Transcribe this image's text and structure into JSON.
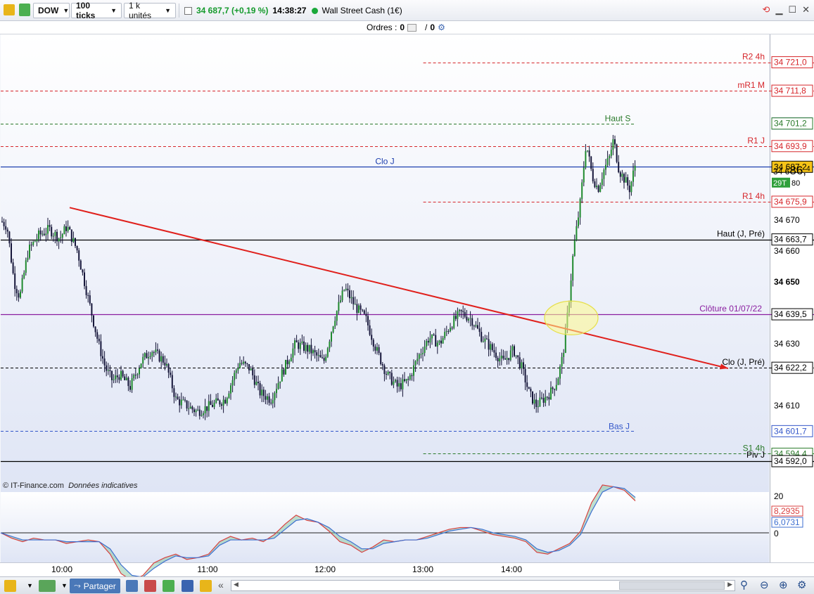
{
  "toolbar": {
    "instrument": "DOW",
    "ticks": "100 ticks",
    "units": "1 k unités",
    "price_change": "34 687,7 (+0,19 %)",
    "time": "14:38:27",
    "market_name": "Wall Street Cash (1€)"
  },
  "orders": {
    "label": "Ordres :",
    "count_a": "0",
    "slash": "/",
    "count_b": "0"
  },
  "price_axis": {
    "ticks": [
      "34 670",
      "34 660",
      "34 650",
      "34 630",
      "34 610"
    ],
    "boxes": [
      {
        "text": "34 721,0",
        "price": 34721.0,
        "color": "#d6262b",
        "bg": "#ffffff"
      },
      {
        "text": "34 711,8",
        "price": 34711.8,
        "color": "#d6262b",
        "bg": "#ffffff"
      },
      {
        "text": "34 701,2",
        "price": 34701.2,
        "color": "#3457c9",
        "bg": "#ffffff"
      },
      {
        "text": "34 701,2",
        "price": 34701.2,
        "color": "#2a7a2a",
        "bg": "#ffffff"
      },
      {
        "text": "34 693,9",
        "price": 34693.9,
        "color": "#d6262b",
        "bg": "#ffffff"
      },
      {
        "text": "34 687,2",
        "price": 34687.2,
        "color": "#000000",
        "bg": "#f6c417"
      },
      {
        "text": "34 675,9",
        "price": 34675.9,
        "color": "#d6262b",
        "bg": "#ffffff"
      },
      {
        "text": "34 663,7",
        "price": 34663.7,
        "color": "#000000",
        "bg": "#ffffff"
      },
      {
        "text": "34 639,5",
        "price": 34639.5,
        "color": "#000000",
        "bg": "#ffffff"
      },
      {
        "text": "34 622,2",
        "price": 34622.2,
        "color": "#000000",
        "bg": "#ffffff"
      },
      {
        "text": "34 601,7",
        "price": 34601.7,
        "color": "#3457c9",
        "bg": "#ffffff"
      },
      {
        "text": "34 594,4",
        "price": 34594.4,
        "color": "#2a7a2a",
        "bg": "#ffffff"
      },
      {
        "text": "34 592,0",
        "price": 34592.0,
        "color": "#000000",
        "bg": "#ffffff"
      }
    ],
    "current_price": "34 686,4",
    "timer": "29T",
    "timer_value": "80"
  },
  "levels": [
    {
      "label": "R2 4h",
      "price": 34721.0,
      "color": "#d6262b",
      "style": "dashed",
      "start": 0.55
    },
    {
      "label": "mR1 M",
      "price": 34711.8,
      "color": "#d6262b",
      "style": "dashed",
      "start": 0
    },
    {
      "label": "Haut S",
      "price": 34701.2,
      "color": "#2a7a2a",
      "style": "dashed",
      "start": 0,
      "end": 0.825
    },
    {
      "label": "R1 J",
      "price": 34693.9,
      "color": "#d6262b",
      "style": "dashed",
      "start": 0
    },
    {
      "label": "Clo J",
      "price": 34687.2,
      "color": "#1d3fae",
      "style": "solid",
      "start": 0
    },
    {
      "label": "R1 4h",
      "price": 34675.9,
      "color": "#d6262b",
      "style": "dashed",
      "start": 0.55
    },
    {
      "label": "Haut (J, Pré)",
      "price": 34663.7,
      "color": "#000000",
      "style": "solid",
      "start": 0
    },
    {
      "label": "Clôture 01/07/22",
      "price": 34639.5,
      "color": "#8a1ea0",
      "style": "solid",
      "start": 0
    },
    {
      "label": "Clo (J, Pré)",
      "price": 34622.2,
      "color": "#000000",
      "style": "dashed",
      "start": 0
    },
    {
      "label": "Bas J",
      "price": 34601.7,
      "color": "#3457c9",
      "style": "dashed",
      "start": 0,
      "end": 0.825
    },
    {
      "label": "S1 4h",
      "price": 34594.4,
      "color": "#2a7a2a",
      "style": "dashed",
      "start": 0.55
    },
    {
      "label": "Piv J",
      "price": 34592.0,
      "color": "#000000",
      "style": "solid",
      "start": 0
    }
  ],
  "chart_data": {
    "type": "candlestick",
    "instrument": "Wall Street Cash (1€)",
    "x_ticks": [
      "10:00",
      "11:00",
      "12:00",
      "13:00",
      "14:00"
    ],
    "y_range": [
      34582,
      34730
    ],
    "close_path": [
      [
        0,
        34670
      ],
      [
        10,
        34668
      ],
      [
        20,
        34650
      ],
      [
        28,
        34645
      ],
      [
        40,
        34660
      ],
      [
        55,
        34665
      ],
      [
        70,
        34667
      ],
      [
        85,
        34664
      ],
      [
        95,
        34668
      ],
      [
        110,
        34660
      ],
      [
        120,
        34650
      ],
      [
        130,
        34640
      ],
      [
        140,
        34630
      ],
      [
        150,
        34622
      ],
      [
        160,
        34618
      ],
      [
        170,
        34620
      ],
      [
        185,
        34616
      ],
      [
        200,
        34624
      ],
      [
        215,
        34628
      ],
      [
        235,
        34624
      ],
      [
        250,
        34612
      ],
      [
        265,
        34610
      ],
      [
        280,
        34608
      ],
      [
        300,
        34610
      ],
      [
        320,
        34612
      ],
      [
        340,
        34624
      ],
      [
        355,
        34622
      ],
      [
        370,
        34614
      ],
      [
        385,
        34612
      ],
      [
        400,
        34620
      ],
      [
        420,
        34630
      ],
      [
        440,
        34628
      ],
      [
        460,
        34624
      ],
      [
        475,
        34638
      ],
      [
        490,
        34648
      ],
      [
        505,
        34642
      ],
      [
        520,
        34638
      ],
      [
        535,
        34628
      ],
      [
        550,
        34620
      ],
      [
        565,
        34616
      ],
      [
        580,
        34618
      ],
      [
        595,
        34626
      ],
      [
        610,
        34632
      ],
      [
        625,
        34630
      ],
      [
        640,
        34636
      ],
      [
        655,
        34640
      ],
      [
        670,
        34638
      ],
      [
        685,
        34632
      ],
      [
        700,
        34628
      ],
      [
        715,
        34624
      ],
      [
        730,
        34628
      ],
      [
        742,
        34622
      ],
      [
        752,
        34614
      ],
      [
        762,
        34610
      ],
      [
        772,
        34612
      ],
      [
        782,
        34614
      ],
      [
        792,
        34618
      ],
      [
        800,
        34626
      ],
      [
        808,
        34642
      ],
      [
        815,
        34660
      ],
      [
        825,
        34676
      ],
      [
        833,
        34695
      ],
      [
        842,
        34684
      ],
      [
        850,
        34680
      ],
      [
        858,
        34686
      ],
      [
        866,
        34690
      ],
      [
        872,
        34696
      ],
      [
        880,
        34686
      ],
      [
        888,
        34683
      ],
      [
        895,
        34680
      ],
      [
        903,
        34688
      ]
    ],
    "trendline": {
      "from": [
        99,
        34674
      ],
      "to": [
        1035,
        34622
      ],
      "color": "#e0201c"
    },
    "annotations": [
      "Clôture 01/07/22",
      "Haut S",
      "Bas J"
    ],
    "oscillator": {
      "scale": [
        20,
        0
      ],
      "labels": [
        "20",
        "8,2935",
        "6,0731",
        "0"
      ],
      "series": [
        {
          "name": "fast",
          "color": "#d94040",
          "values": [
            0,
            -3,
            -5,
            -3,
            -4,
            -4,
            -6,
            -5,
            -4,
            -5,
            -12,
            -23,
            -27,
            -24,
            -17,
            -14,
            -12,
            -15,
            -14,
            -12,
            -5,
            -2,
            -4,
            -3,
            -5,
            -1,
            5,
            10,
            7,
            6,
            1,
            -5,
            -7,
            -11,
            -8,
            -4,
            -5,
            -4,
            -4,
            -2,
            0,
            2,
            3,
            3,
            1,
            -1,
            -2,
            -3,
            -5,
            -11,
            -12,
            -9,
            -6,
            1,
            17,
            27,
            26,
            24,
            18
          ]
        },
        {
          "name": "slow",
          "color": "#3d6fd0",
          "values": [
            0,
            -2,
            -4,
            -4,
            -4,
            -4,
            -5,
            -5,
            -5,
            -5,
            -9,
            -18,
            -24,
            -25,
            -20,
            -16,
            -13,
            -14,
            -14,
            -13,
            -7,
            -4,
            -4,
            -4,
            -4,
            -3,
            2,
            7,
            8,
            6,
            3,
            -2,
            -5,
            -9,
            -9,
            -6,
            -5,
            -4,
            -4,
            -3,
            -1,
            1,
            2,
            3,
            2,
            0,
            -1,
            -2,
            -4,
            -9,
            -11,
            -10,
            -7,
            -1,
            12,
            23,
            26,
            25,
            20
          ]
        }
      ]
    }
  },
  "footer": {
    "copyright": "© IT-Finance.com",
    "disclaimer": "Données indicatives",
    "share_label": "Partager"
  }
}
